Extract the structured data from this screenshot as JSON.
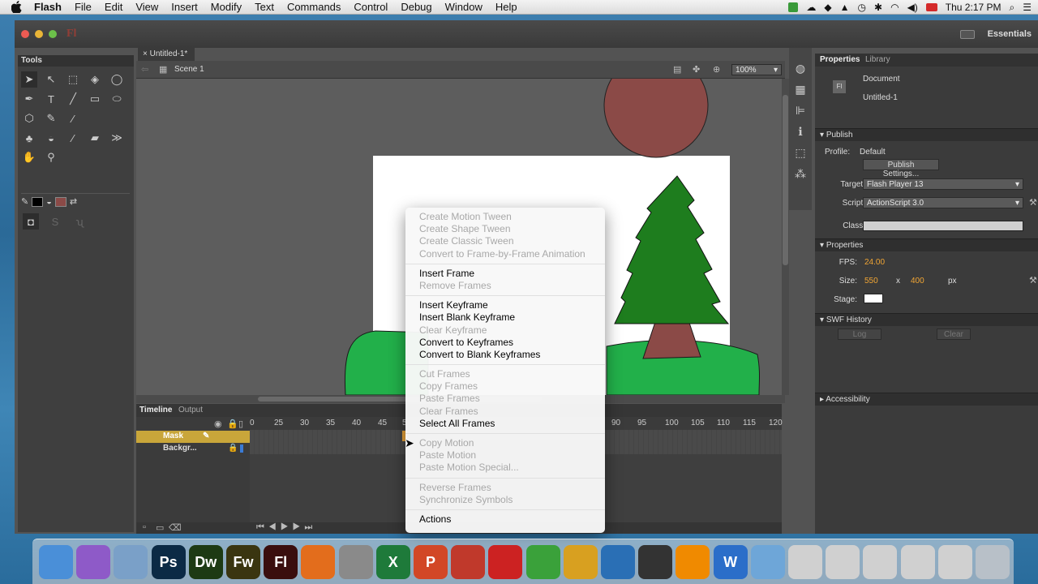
{
  "menubar": {
    "app": "Flash",
    "items": [
      "File",
      "Edit",
      "View",
      "Insert",
      "Modify",
      "Text",
      "Commands",
      "Control",
      "Debug",
      "Window",
      "Help"
    ],
    "clock": "Thu 2:17 PM"
  },
  "window": {
    "logo": "Fl",
    "workspace": "Essentials"
  },
  "tools": {
    "title": "Tools"
  },
  "document": {
    "tab": "Untitled-1*",
    "scene": "Scene 1",
    "zoom": "100%"
  },
  "timeline": {
    "tabs": [
      "Timeline",
      "Output"
    ],
    "ruler": [
      "0",
      "25",
      "30",
      "35",
      "40",
      "45",
      "5",
      "90",
      "95",
      "100",
      "105",
      "110",
      "115",
      "120"
    ],
    "layers": [
      {
        "name": "Mask"
      },
      {
        "name": "Backgr..."
      }
    ]
  },
  "properties": {
    "tabs": [
      "Properties",
      "Library"
    ],
    "doc_icon": "Fl",
    "doc_type": "Document",
    "doc_name": "Untitled-1",
    "publish": {
      "header": "Publish",
      "profile_label": "Profile:",
      "profile": "Default",
      "settings_button": "Publish Settings...",
      "target_label": "Target:",
      "target": "Flash Player 13",
      "script_label": "Script:",
      "script": "ActionScript 3.0",
      "class_label": "Class:"
    },
    "props": {
      "header": "Properties",
      "fps_label": "FPS:",
      "fps": "24.00",
      "size_label": "Size:",
      "width": "550",
      "x": "x",
      "height": "400",
      "unit": "px",
      "stage_label": "Stage:"
    },
    "swf": {
      "header": "SWF History",
      "log": "Log",
      "clear": "Clear"
    },
    "access": {
      "header": "Accessibility"
    }
  },
  "context_menu": {
    "groups": [
      [
        {
          "label": "Create Motion Tween",
          "enabled": false
        },
        {
          "label": "Create Shape Tween",
          "enabled": false
        },
        {
          "label": "Create Classic Tween",
          "enabled": false
        },
        {
          "label": "Convert to Frame-by-Frame Animation",
          "enabled": false
        }
      ],
      [
        {
          "label": "Insert Frame",
          "enabled": true
        },
        {
          "label": "Remove Frames",
          "enabled": false
        }
      ],
      [
        {
          "label": "Insert Keyframe",
          "enabled": true
        },
        {
          "label": "Insert Blank Keyframe",
          "enabled": true
        },
        {
          "label": "Clear Keyframe",
          "enabled": false
        },
        {
          "label": "Convert to Keyframes",
          "enabled": true
        },
        {
          "label": "Convert to Blank Keyframes",
          "enabled": true
        }
      ],
      [
        {
          "label": "Cut Frames",
          "enabled": false
        },
        {
          "label": "Copy Frames",
          "enabled": false
        },
        {
          "label": "Paste Frames",
          "enabled": false
        },
        {
          "label": "Clear Frames",
          "enabled": false
        },
        {
          "label": "Select All Frames",
          "enabled": true
        }
      ],
      [
        {
          "label": "Copy Motion",
          "enabled": false
        },
        {
          "label": "Paste Motion",
          "enabled": false
        },
        {
          "label": "Paste Motion Special...",
          "enabled": false
        }
      ],
      [
        {
          "label": "Reverse Frames",
          "enabled": false
        },
        {
          "label": "Synchronize Symbols",
          "enabled": false
        }
      ],
      [
        {
          "label": "Actions",
          "enabled": true
        }
      ]
    ]
  },
  "dock": [
    {
      "name": "finder",
      "label": "",
      "color": "#4a8fd8"
    },
    {
      "name": "game-center",
      "label": "",
      "color": "#8e5ac8"
    },
    {
      "name": "preview",
      "label": "",
      "color": "#7aa0c8"
    },
    {
      "name": "photoshop",
      "label": "Ps",
      "color": "#0b2a45"
    },
    {
      "name": "dreamweaver",
      "label": "Dw",
      "color": "#1d3a14"
    },
    {
      "name": "fireworks",
      "label": "Fw",
      "color": "#3a3510"
    },
    {
      "name": "flash",
      "label": "Fl",
      "color": "#3a0e0e"
    },
    {
      "name": "firefox",
      "label": "",
      "color": "#e36d1c"
    },
    {
      "name": "system-preferences",
      "label": "",
      "color": "#8a8a8a"
    },
    {
      "name": "excel",
      "label": "X",
      "color": "#1e7a3a"
    },
    {
      "name": "powerpoint",
      "label": "P",
      "color": "#d24726"
    },
    {
      "name": "utility",
      "label": "",
      "color": "#c0392b"
    },
    {
      "name": "sketchup",
      "label": "",
      "color": "#cc2222"
    },
    {
      "name": "gps-app",
      "label": "",
      "color": "#3aa13a"
    },
    {
      "name": "fetch",
      "label": "",
      "color": "#d8a020"
    },
    {
      "name": "quicktime",
      "label": "",
      "color": "#2a6fb5"
    },
    {
      "name": "camera-app",
      "label": "",
      "color": "#333333"
    },
    {
      "name": "vlc",
      "label": "",
      "color": "#f08a00"
    },
    {
      "name": "word",
      "label": "W",
      "color": "#2b6ec9"
    },
    {
      "name": "downloads-folder",
      "label": "",
      "color": "#6ea6d8"
    },
    {
      "name": "window-1",
      "label": "",
      "color": "#d0d0d0"
    },
    {
      "name": "window-2",
      "label": "",
      "color": "#d0d0d0"
    },
    {
      "name": "window-3",
      "label": "",
      "color": "#d0d0d0"
    },
    {
      "name": "window-4",
      "label": "",
      "color": "#d0d0d0"
    },
    {
      "name": "window-5",
      "label": "",
      "color": "#d0d0d0"
    },
    {
      "name": "trash",
      "label": "",
      "color": "#b8c0c8"
    }
  ],
  "colors": {
    "stroke_color": "#000000",
    "fill_color": "#8b4a47",
    "layer_selected": "#c9a63a"
  }
}
